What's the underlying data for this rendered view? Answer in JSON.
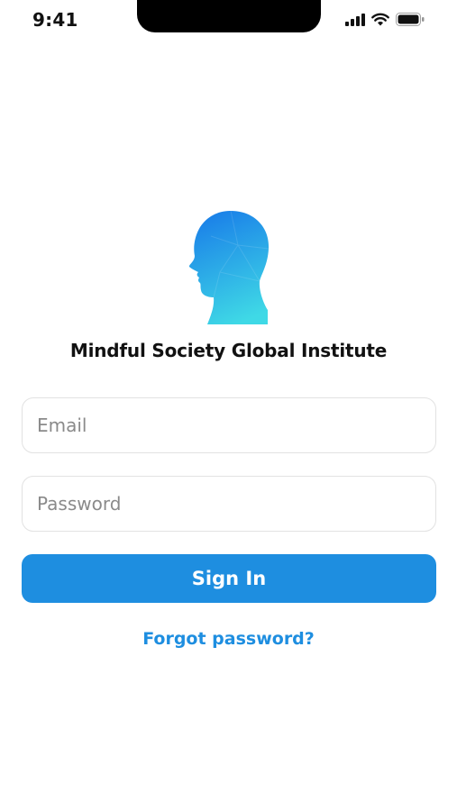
{
  "status_bar": {
    "time": "9:41",
    "icons": [
      "cellular-signal-icon",
      "wifi-icon",
      "battery-icon"
    ]
  },
  "logo": {
    "icon": "head-profile-icon",
    "colors": {
      "top": "#1a7fe8",
      "bottom": "#3fd9e6"
    }
  },
  "brand": {
    "title": "Mindful Society Global Institute"
  },
  "form": {
    "email_placeholder": "Email",
    "email_value": "",
    "password_placeholder": "Password",
    "password_value": "",
    "sign_in_label": "Sign In",
    "forgot_label": "Forgot password?"
  },
  "colors": {
    "accent": "#1e8ee0",
    "field_border": "#e2e2e2",
    "text": "#111111"
  }
}
